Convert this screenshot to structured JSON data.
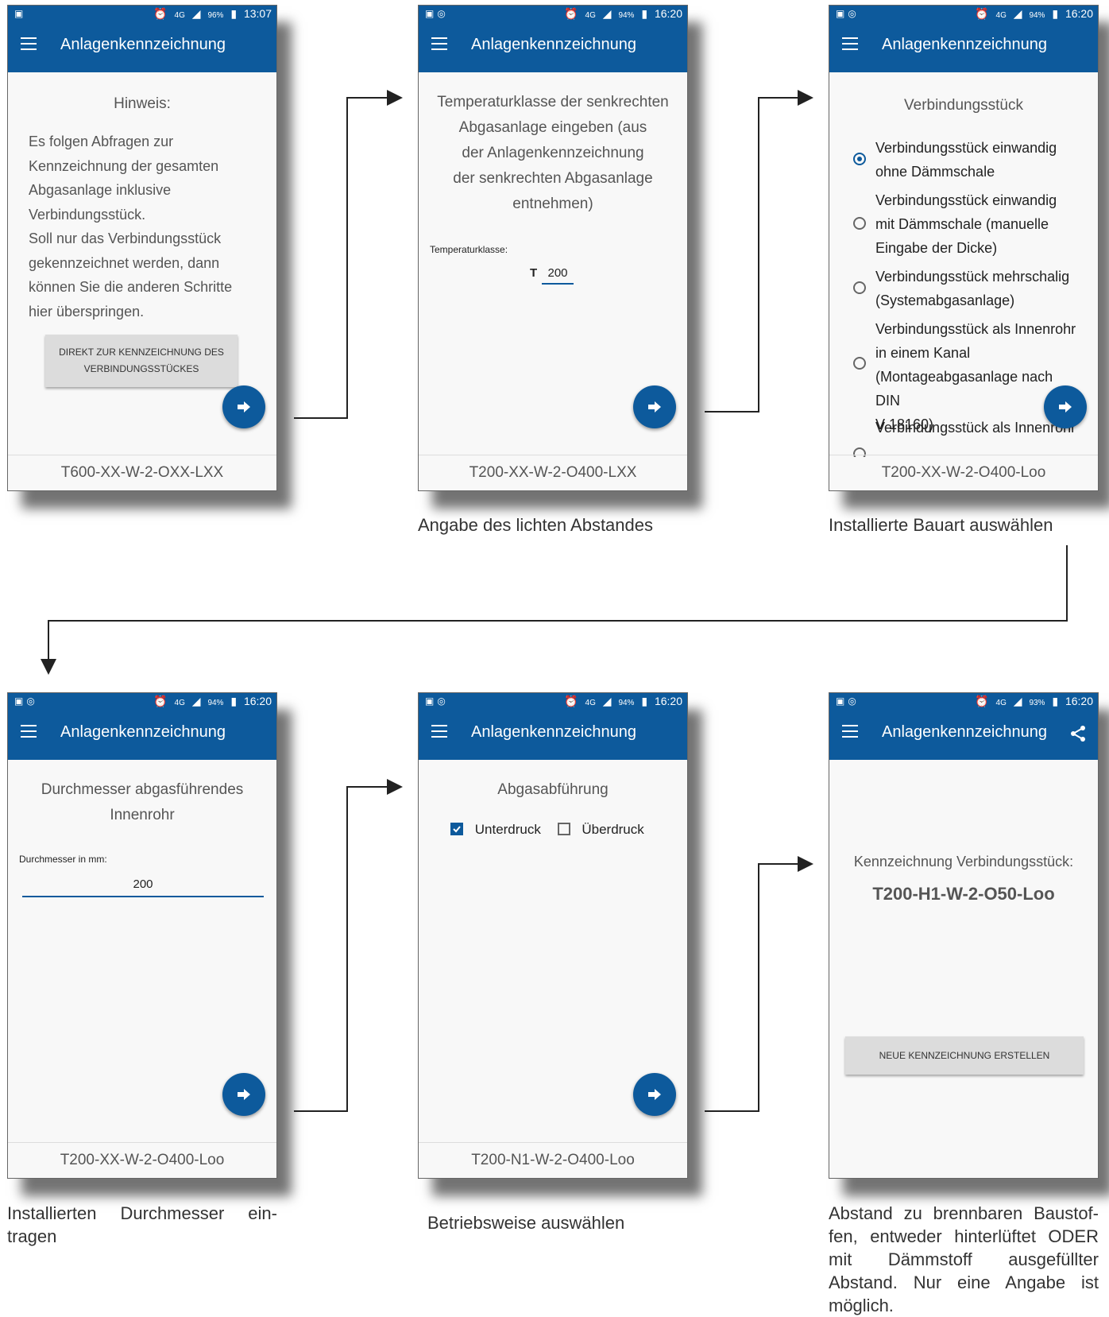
{
  "app_title": "Anlagenkennzeichnung",
  "screens": [
    {
      "status": {
        "time": "13:07",
        "battery": "96%",
        "network": "4G"
      },
      "heading": "Hinweis:",
      "body_lines": [
        "Es folgen Abfragen zur",
        "Kennzeichnung der gesamten",
        "Abgasanlage inklusive",
        "Verbindungsstück.",
        "Soll nur das Verbindungsstück",
        "gekennzeichnet werden, dann",
        "können Sie die anderen Schritte",
        "hier überspringen."
      ],
      "button_line1": "DIREKT ZUR KENNZEICHNUNG DES",
      "button_line2": "VERBINDUNGSSTÜCKES",
      "footer": "T600-XX-W-2-OXX-LXX"
    },
    {
      "status": {
        "time": "16:20",
        "battery": "94%",
        "network": "4G"
      },
      "heading_lines": [
        "Temperaturklasse der senkrechten",
        "Abgasanlage eingeben (aus",
        "der Anlagenkennzeichnung",
        "der senkrechten Abgasanlage",
        "entnehmen)"
      ],
      "field_label": "Temperaturklasse:",
      "field_prefix": "T",
      "field_value": "200",
      "footer": "T200-XX-W-2-O400-LXX",
      "caption": "Angabe des lichten Abstandes"
    },
    {
      "status": {
        "time": "16:20",
        "battery": "94%",
        "network": "4G"
      },
      "heading": "Verbindungsstück",
      "options": [
        {
          "lines": [
            "Verbindungsstück einwandig",
            "ohne Dämmschale"
          ],
          "checked": true
        },
        {
          "lines": [
            "Verbindungsstück einwandig",
            "mit Dämmschale (manuelle",
            "Eingabe der Dicke)"
          ],
          "checked": false
        },
        {
          "lines": [
            "Verbindungsstück mehrschalig",
            "(Systemabgasanlage)"
          ],
          "checked": false
        },
        {
          "lines": [
            "Verbindungsstück als Innenrohr",
            "in einem Kanal",
            "(Montageabgasanlage nach DIN",
            "V 18160)"
          ],
          "checked": false
        },
        {
          "lines": [
            "Verbindungsstück als Innenrohr"
          ],
          "checked": false
        }
      ],
      "footer": "T200-XX-W-2-O400-Loo",
      "caption": "Installierte Bauart auswählen"
    },
    {
      "status": {
        "time": "16:20",
        "battery": "94%",
        "network": "4G"
      },
      "heading_lines": [
        "Durchmesser abgasführendes",
        "Innenrohr"
      ],
      "field_label": "Durchmesser in mm:",
      "field_value": "200",
      "footer": "T200-XX-W-2-O400-Loo",
      "caption_lines": [
        "Installierten Durchmesser ein-",
        "tragen"
      ]
    },
    {
      "status": {
        "time": "16:20",
        "battery": "94%",
        "network": "4G"
      },
      "heading": "Abgasabführung",
      "checkbox1": "Unterdruck",
      "checkbox2": "Überdruck",
      "footer": "T200-N1-W-2-O400-Loo",
      "caption": "Betriebsweise auswählen"
    },
    {
      "status": {
        "time": "16:20",
        "battery": "93%",
        "network": "4G"
      },
      "result_label": "Kennzeichnung Verbindungsstück:",
      "result_value": "T200-H1-W-2-O50-Loo",
      "button": "NEUE KENNZEICHNUNG ERSTELLEN",
      "caption_lines": [
        "Abstand zu brennbaren Baustof-",
        "fen, entweder hinterlüftet ODER",
        "mit Dämmstoff ausgefüllter",
        "Abstand. Nur eine Angabe ist",
        "möglich."
      ]
    }
  ]
}
